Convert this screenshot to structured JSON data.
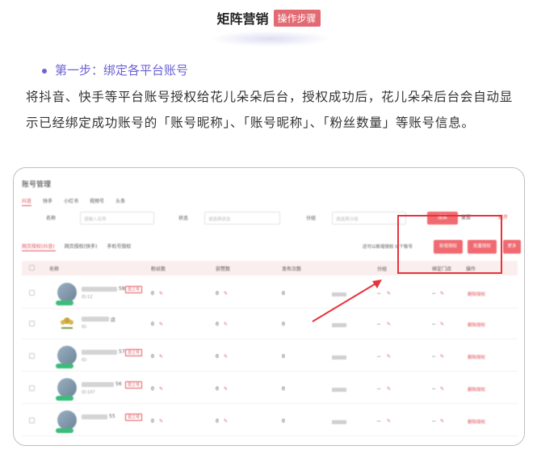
{
  "header": {
    "title": "矩阵营销",
    "badge": "操作步骤"
  },
  "step": {
    "label": "第一步：绑定各平台账号"
  },
  "description": "将抖音、快手等平台账号授权给花儿朵朵后台，授权成功后，花儿朵朵后台会自动显示已经绑定成功账号的「账号昵称」、「账号昵称」、「粉丝数量」等账号信息。",
  "screenshot": {
    "page_title": "账号管理",
    "platform_tabs": [
      "抖音",
      "快手",
      "小红书",
      "视频号",
      "头条"
    ],
    "filters": {
      "name_label": "名称",
      "name_placeholder": "请输入名称",
      "status_label": "状态",
      "status_placeholder": "请选择状态",
      "group_label": "分组",
      "group_placeholder": "请选择分组",
      "search_btn": "搜索",
      "reset_btn": "重置",
      "expand_link": "展开"
    },
    "auth_tabs": [
      "网页授权(抖音)",
      "网页授权(快手)",
      "手机号授权"
    ],
    "quota_note": "还可以新增授权 0 个账号",
    "action_buttons": {
      "new_auth": "新增授权",
      "batch_auth": "批量授权",
      "more": "更多"
    },
    "columns": [
      "名称",
      "粉丝数",
      "获赞数",
      "发布次数",
      "分组",
      "绑定门店",
      "操作"
    ],
    "rows": [
      {
        "suffix": "58",
        "tag": "员工号",
        "id": "ID:12",
        "fans": "0",
        "likes": "0",
        "posts": "0",
        "group": "--",
        "store": "--",
        "action": "删除授权"
      },
      {
        "suffix": "店",
        "tag": "",
        "id": "ID:",
        "fans": "0",
        "likes": "0",
        "posts": "0",
        "group": "--",
        "store": "--",
        "action": "删除授权"
      },
      {
        "suffix": "57",
        "tag": "员工号",
        "id": "ID:",
        "fans": "0",
        "likes": "0",
        "posts": "0",
        "group": "--",
        "store": "--",
        "action": "删除授权"
      },
      {
        "suffix": "56",
        "tag": "员工号",
        "id": "ID:107",
        "fans": "0",
        "likes": "0",
        "posts": "0",
        "group": "--",
        "store": "--",
        "action": "删除授权"
      },
      {
        "suffix": "55",
        "tag": "员工号",
        "id": "",
        "fans": "0",
        "likes": "0",
        "posts": "0",
        "group": "--",
        "store": "--",
        "action": "删除授权"
      }
    ]
  },
  "colors": {
    "accent": "#e0505a",
    "step": "#6b62d6",
    "annotation": "#e8323c"
  }
}
